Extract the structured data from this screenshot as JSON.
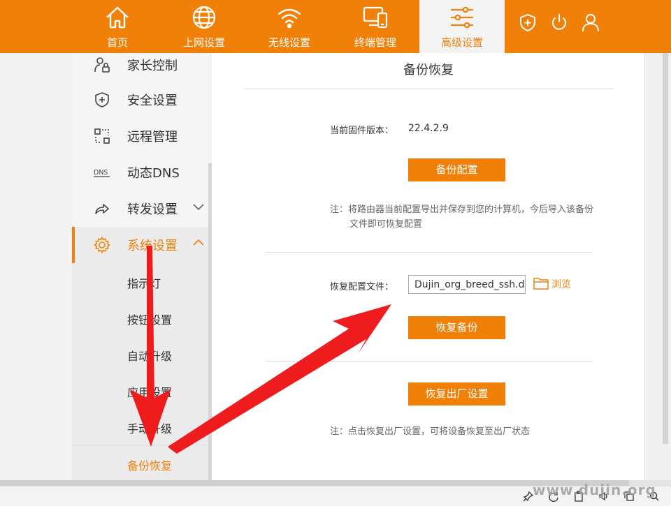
{
  "colors": {
    "accent": "#f08008",
    "annotation_arrow": "#ee1c1c"
  },
  "nav": {
    "items": [
      {
        "label": "首页",
        "icon": "home-icon"
      },
      {
        "label": "上网设置",
        "icon": "globe-icon"
      },
      {
        "label": "无线设置",
        "icon": "wifi-icon"
      },
      {
        "label": "终端管理",
        "icon": "devices-icon"
      },
      {
        "label": "高级设置",
        "icon": "sliders-icon",
        "active": true
      }
    ],
    "right_icons": [
      "shield-plus-icon",
      "power-icon",
      "user-icon"
    ]
  },
  "sidebar": {
    "items": [
      {
        "label": "家长控制",
        "icon": "parental-icon"
      },
      {
        "label": "安全设置",
        "icon": "shield-plus-icon"
      },
      {
        "label": "远程管理",
        "icon": "remote-icon"
      },
      {
        "label": "动态DNS",
        "icon": "dns-icon",
        "icon_text": "DNS"
      },
      {
        "label": "转发设置",
        "icon": "forward-icon"
      },
      {
        "label": "系统设置",
        "icon": "gear-icon",
        "expanded": true
      }
    ],
    "sub_items": [
      {
        "label": "指示灯"
      },
      {
        "label": "按钮设置"
      },
      {
        "label": "自动升级"
      },
      {
        "label": "应用设置"
      },
      {
        "label": "手动升级"
      },
      {
        "label": "备份恢复",
        "active": true
      }
    ]
  },
  "content": {
    "title": "备份恢复",
    "firmware_label": "当前固件版本：",
    "firmware_version": "22.4.2.9",
    "backup_button": "备份配置",
    "backup_note_line1": "注：将路由器当前配置导出并保存到您的计算机，今后导入该备份",
    "backup_note_line2": "文件即可恢复配置",
    "restore_file_label": "恢复配置文件：",
    "restore_file_value": "Dujin_org_breed_ssh.dat",
    "browse_label": "浏览",
    "restore_button": "恢复备份",
    "factory_button": "恢复出厂设置",
    "factory_note": "注：点击恢复出厂设置，可将设备恢复至出厂状态"
  },
  "watermark": "www.dujin.org",
  "taskbar_icons": [
    "pin-icon",
    "refresh-icon",
    "clipboard-icon",
    "volume-icon",
    "copy-icon",
    "search-icon"
  ]
}
